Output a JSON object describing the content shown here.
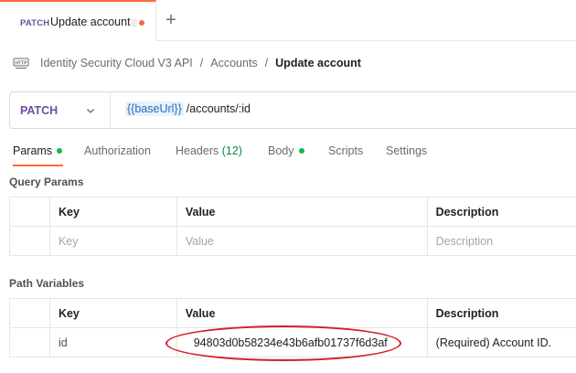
{
  "tab": {
    "method": "PATCH",
    "title": "Update account"
  },
  "new_tab_symbol": "+",
  "breadcrumb": {
    "items": [
      "Identity Security Cloud V3 API",
      "Accounts",
      "Update account"
    ],
    "separator": "/"
  },
  "request": {
    "method": "PATCH",
    "url_variable": "{{baseUrl}}",
    "url_path": "/accounts/:id"
  },
  "request_tabs": {
    "params": "Params",
    "authorization": "Authorization",
    "headers": "Headers",
    "headers_count": "(12)",
    "body": "Body",
    "scripts": "Scripts",
    "settings": "Settings"
  },
  "query_params": {
    "title": "Query Params",
    "headers": {
      "key": "Key",
      "value": "Value",
      "description": "Description"
    },
    "placeholders": {
      "key": "Key",
      "value": "Value",
      "description": "Description"
    }
  },
  "path_variables": {
    "title": "Path Variables",
    "headers": {
      "key": "Key",
      "value": "Value",
      "description": "Description"
    },
    "rows": [
      {
        "key": "id",
        "value": "94803d0b58234e43b6afb01737f6d3af",
        "description": "(Required) Account ID."
      }
    ]
  },
  "colors": {
    "accent": "#ff6c37",
    "method": "#6b4ea3",
    "status_dot": "#0cbb52",
    "annotation": "#d21f26"
  }
}
